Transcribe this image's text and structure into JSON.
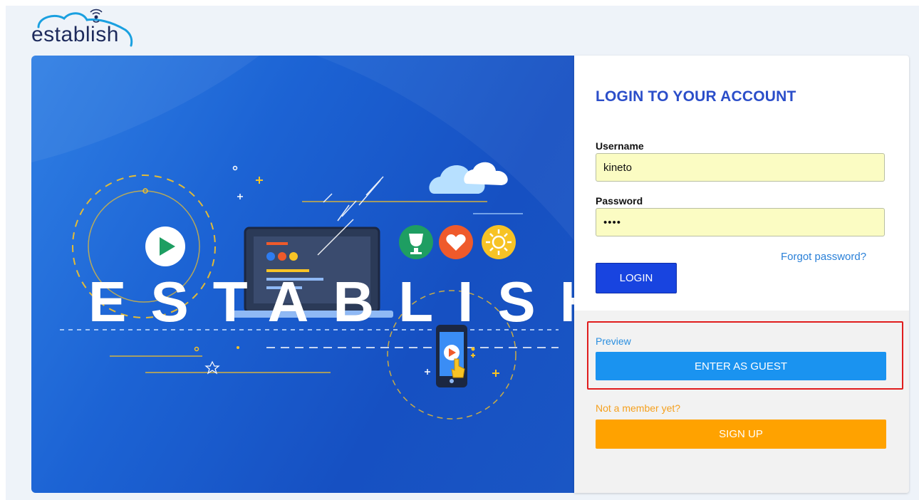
{
  "brand": {
    "logo_text": "establish"
  },
  "hero": {
    "word": "ESTABLISH",
    "colors": {
      "bg_start": "#2f7fe4",
      "bg_end": "#1650c2",
      "accent_yellow": "#f7c325",
      "accent_green": "#1e9e62",
      "accent_orange": "#ef5a2b"
    }
  },
  "login": {
    "title": "LOGIN TO YOUR ACCOUNT",
    "username_label": "Username",
    "username_value": "kineto",
    "password_label": "Password",
    "password_value": "••••",
    "forgot_link": "Forgot password?",
    "login_button": "LOGIN"
  },
  "guest": {
    "preview_label": "Preview",
    "enter_button": "ENTER AS GUEST"
  },
  "signup": {
    "prompt": "Not a member yet?",
    "button": "SIGN UP"
  },
  "colors": {
    "title_blue": "#2b4ec9",
    "login_button": "#1844e0",
    "guest_button": "#1a93f0",
    "signup_button": "#ffa200",
    "highlight_red": "#e01d1d",
    "input_fill": "#fbfcc3"
  },
  "icons": [
    "cloud-wifi-logo-icon",
    "play-icon",
    "trophy-icon",
    "heart-icon",
    "sun-icon",
    "cloud-icon",
    "smartphone-icon",
    "pointer-hand-icon",
    "laptop-icon"
  ]
}
